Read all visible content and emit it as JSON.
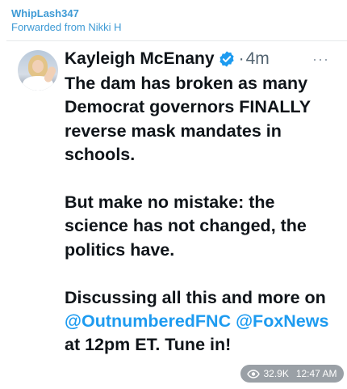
{
  "message": {
    "sender": "WhipLash347",
    "forwarded_from": "Forwarded from Nikki H"
  },
  "tweet": {
    "author": "Kayleigh McEnany",
    "separator": "·",
    "time": "4m",
    "more": "···",
    "paragraph1": "The dam has broken as many Democrat governors FINALLY reverse mask mandates in schools.",
    "paragraph2": "But make no mistake: the science has not changed, the politics have.",
    "paragraph3_start": "Discussing all this and more on ",
    "mention1": "@OutnumberedFNC",
    "mention2": "@FoxNews",
    "paragraph3_end": " at 12pm ET. Tune in!"
  },
  "meta": {
    "views": "32.9K",
    "timestamp": "12:47 AM",
    "icon": "eye-icon"
  },
  "colors": {
    "sender": "#3d9ad5",
    "mention": "#1d9bf0",
    "verified": "#1d9bf0",
    "pill": "#9aa0a6"
  }
}
